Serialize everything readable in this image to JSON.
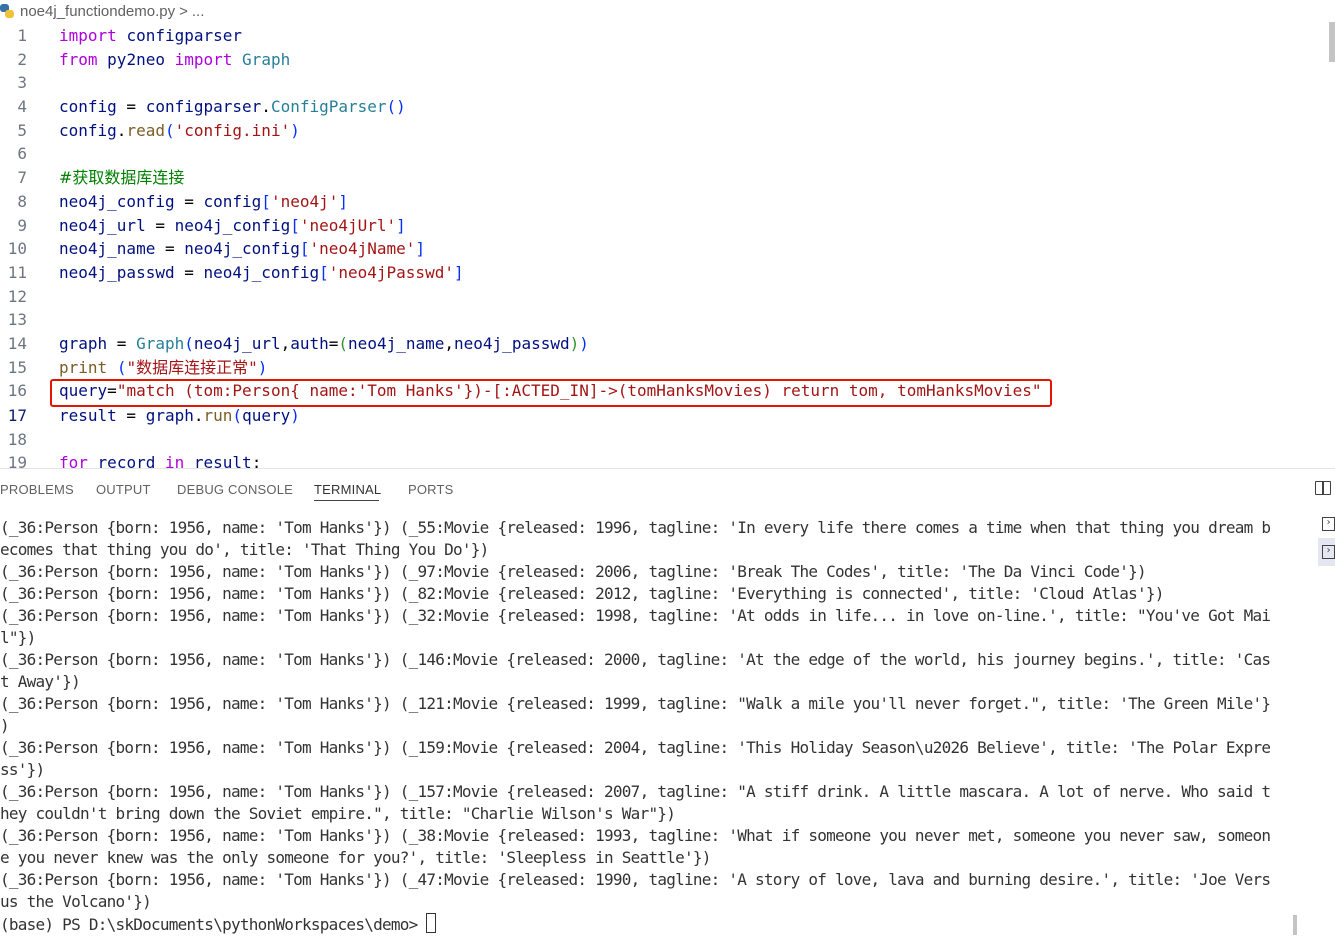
{
  "breadcrumb": {
    "file": "noe4j_functiondemo.py",
    "separator": ">",
    "more": "..."
  },
  "editor": {
    "active_line": "17",
    "lines": [
      {
        "n": "1",
        "tokens": [
          [
            "kw",
            "import"
          ],
          [
            "op",
            " "
          ],
          [
            "id",
            "configparser"
          ]
        ]
      },
      {
        "n": "2",
        "tokens": [
          [
            "kw",
            "from"
          ],
          [
            "op",
            " "
          ],
          [
            "id",
            "py2neo"
          ],
          [
            "op",
            " "
          ],
          [
            "kw",
            "import"
          ],
          [
            "op",
            " "
          ],
          [
            "cls",
            "Graph"
          ]
        ]
      },
      {
        "n": "3",
        "tokens": []
      },
      {
        "n": "4",
        "tokens": [
          [
            "id",
            "config"
          ],
          [
            "op",
            " = "
          ],
          [
            "id",
            "configparser"
          ],
          [
            "op",
            "."
          ],
          [
            "cls",
            "ConfigParser"
          ],
          [
            "br1",
            "()"
          ]
        ]
      },
      {
        "n": "5",
        "tokens": [
          [
            "id",
            "config"
          ],
          [
            "op",
            "."
          ],
          [
            "fn",
            "read"
          ],
          [
            "br1",
            "("
          ],
          [
            "str",
            "'config.ini'"
          ],
          [
            "br1",
            ")"
          ]
        ]
      },
      {
        "n": "6",
        "tokens": []
      },
      {
        "n": "7",
        "tokens": [
          [
            "cm",
            "#获取数据库连接"
          ]
        ]
      },
      {
        "n": "8",
        "tokens": [
          [
            "id",
            "neo4j_config"
          ],
          [
            "op",
            " = "
          ],
          [
            "id",
            "config"
          ],
          [
            "br1",
            "["
          ],
          [
            "str",
            "'neo4j'"
          ],
          [
            "br1",
            "]"
          ]
        ]
      },
      {
        "n": "9",
        "tokens": [
          [
            "id",
            "neo4j_url"
          ],
          [
            "op",
            " = "
          ],
          [
            "id",
            "neo4j_config"
          ],
          [
            "br1",
            "["
          ],
          [
            "str",
            "'neo4jUrl'"
          ],
          [
            "br1",
            "]"
          ]
        ]
      },
      {
        "n": "10",
        "tokens": [
          [
            "id",
            "neo4j_name"
          ],
          [
            "op",
            " = "
          ],
          [
            "id",
            "neo4j_config"
          ],
          [
            "br1",
            "["
          ],
          [
            "str",
            "'neo4jName'"
          ],
          [
            "br1",
            "]"
          ]
        ]
      },
      {
        "n": "11",
        "tokens": [
          [
            "id",
            "neo4j_passwd"
          ],
          [
            "op",
            " = "
          ],
          [
            "id",
            "neo4j_config"
          ],
          [
            "br1",
            "["
          ],
          [
            "str",
            "'neo4jPasswd'"
          ],
          [
            "br1",
            "]"
          ]
        ]
      },
      {
        "n": "12",
        "tokens": []
      },
      {
        "n": "13",
        "tokens": []
      },
      {
        "n": "14",
        "tokens": [
          [
            "id",
            "graph"
          ],
          [
            "op",
            " = "
          ],
          [
            "cls",
            "Graph"
          ],
          [
            "br1",
            "("
          ],
          [
            "id",
            "neo4j_url"
          ],
          [
            "op",
            ","
          ],
          [
            "id",
            "auth"
          ],
          [
            "op",
            "="
          ],
          [
            "br2",
            "("
          ],
          [
            "id",
            "neo4j_name"
          ],
          [
            "op",
            ","
          ],
          [
            "id",
            "neo4j_passwd"
          ],
          [
            "br2",
            ")"
          ],
          [
            "br1",
            ")"
          ]
        ]
      },
      {
        "n": "15",
        "tokens": [
          [
            "fn",
            "print"
          ],
          [
            "op",
            " "
          ],
          [
            "br1",
            "("
          ],
          [
            "str",
            "\"数据库连接正常\""
          ],
          [
            "br1",
            ")"
          ]
        ]
      },
      {
        "n": "16",
        "tokens": [
          [
            "id",
            "query"
          ],
          [
            "op",
            "="
          ],
          [
            "str",
            "\"match (tom:Person{ name:'Tom Hanks'})-[:ACTED_IN]->(tomHanksMovies) return tom, tomHanksMovies\""
          ]
        ]
      },
      {
        "n": "17",
        "tokens": [
          [
            "id",
            "result"
          ],
          [
            "op",
            " = "
          ],
          [
            "id",
            "graph"
          ],
          [
            "op",
            "."
          ],
          [
            "fn",
            "run"
          ],
          [
            "br1",
            "("
          ],
          [
            "id",
            "query"
          ],
          [
            "br1",
            ")"
          ]
        ]
      },
      {
        "n": "18",
        "tokens": []
      },
      {
        "n": "19",
        "tokens": [
          [
            "kw",
            "for"
          ],
          [
            "op",
            " "
          ],
          [
            "id",
            "record"
          ],
          [
            "op",
            " "
          ],
          [
            "kw",
            "in"
          ],
          [
            "op",
            " "
          ],
          [
            "id",
            "result"
          ],
          [
            "op",
            ":"
          ]
        ]
      }
    ]
  },
  "panel": {
    "tabs": [
      "PROBLEMS",
      "OUTPUT",
      "DEBUG CONSOLE",
      "TERMINAL",
      "PORTS"
    ],
    "active_tab": "TERMINAL"
  },
  "terminal": {
    "lines": [
      "(_36:Person {born: 1956, name: 'Tom Hanks'}) (_55:Movie {released: 1996, tagline: 'In every life there comes a time when that thing you dream b",
      "ecomes that thing you do', title: 'That Thing You Do'})",
      "(_36:Person {born: 1956, name: 'Tom Hanks'}) (_97:Movie {released: 2006, tagline: 'Break The Codes', title: 'The Da Vinci Code'})",
      "(_36:Person {born: 1956, name: 'Tom Hanks'}) (_82:Movie {released: 2012, tagline: 'Everything is connected', title: 'Cloud Atlas'})",
      "(_36:Person {born: 1956, name: 'Tom Hanks'}) (_32:Movie {released: 1998, tagline: 'At odds in life... in love on-line.', title: \"You've Got Mai",
      "l\"})",
      "(_36:Person {born: 1956, name: 'Tom Hanks'}) (_146:Movie {released: 2000, tagline: 'At the edge of the world, his journey begins.', title: 'Cas",
      "t Away'})",
      "(_36:Person {born: 1956, name: 'Tom Hanks'}) (_121:Movie {released: 1999, tagline: \"Walk a mile you'll never forget.\", title: 'The Green Mile'}",
      ")",
      "(_36:Person {born: 1956, name: 'Tom Hanks'}) (_159:Movie {released: 2004, tagline: 'This Holiday Season\\u2026 Believe', title: 'The Polar Expre",
      "ss'})",
      "(_36:Person {born: 1956, name: 'Tom Hanks'}) (_157:Movie {released: 2007, tagline: \"A stiff drink. A little mascara. A lot of nerve. Who said t",
      "hey couldn't bring down the Soviet empire.\", title: \"Charlie Wilson's War\"})",
      "(_36:Person {born: 1956, name: 'Tom Hanks'}) (_38:Movie {released: 1993, tagline: 'What if someone you never met, someone you never saw, someon",
      "e you never knew was the only someone for you?', title: 'Sleepless in Seattle'})",
      "(_36:Person {born: 1956, name: 'Tom Hanks'}) (_47:Movie {released: 1990, tagline: 'A story of love, lava and burning desire.', title: 'Joe Vers",
      "us the Volcano'})"
    ],
    "prompt": "(base) PS D:\\skDocuments\\pythonWorkspaces\\demo> "
  }
}
